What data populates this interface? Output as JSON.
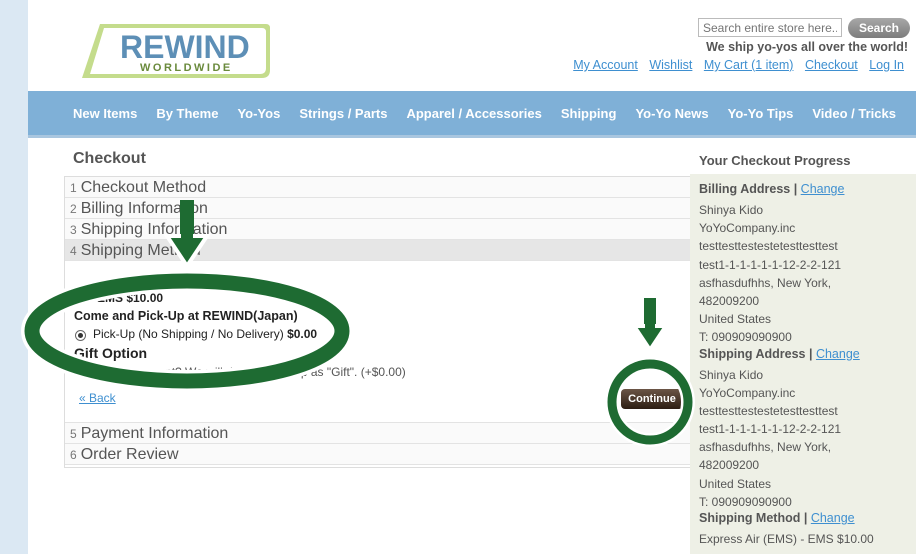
{
  "header": {
    "logo_text": "REWIND",
    "logo_sub": "WORLDWIDE",
    "search_placeholder": "Search entire store here...",
    "search_button": "Search",
    "ship_note": "We ship yo-yos all over the world!",
    "links": [
      "My Account",
      "Wishlist",
      "My Cart (1 item)",
      "Checkout",
      "Log In"
    ]
  },
  "nav": [
    "New Items",
    "By Theme",
    "Yo-Yos",
    "Strings / Parts",
    "Apparel / Accessories",
    "Shipping",
    "Yo-Yo News",
    "Yo-Yo Tips",
    "Video / Tricks"
  ],
  "checkout": {
    "title": "Checkout",
    "steps": [
      {
        "num": "1",
        "label": "Checkout Method"
      },
      {
        "num": "2",
        "label": "Billing Information"
      },
      {
        "num": "3",
        "label": "Shipping Information"
      },
      {
        "num": "4",
        "label": "Shipping Method"
      }
    ],
    "ems": "EMS $10.00",
    "pickup_heading": "Come and Pick-Up at REWIND(Japan)",
    "pickup_option": "Pick-Up (No Shipping / No Delivery)",
    "pickup_price": "$0.00",
    "gift_title": "Gift Option",
    "gift_text": "a present? We will do Gift W...ship as \"Gift\". (+$0.00)",
    "back": "« Back",
    "continue": "Continue",
    "steps_after": [
      {
        "num": "5",
        "label": "Payment Information"
      },
      {
        "num": "6",
        "label": "Order Review"
      }
    ]
  },
  "progress": {
    "title": "Your Checkout Progress",
    "change_label": "Change",
    "billing": {
      "heading": "Billing Address",
      "lines": [
        "Shinya Kido",
        "YoYoCompany.inc",
        "testtesttestestetesttesttest",
        "test1-1-1-1-1-1-12-2-2-121",
        "asfhasdufhhs, New York,",
        "482009200",
        "United States",
        "T: 090909090900"
      ]
    },
    "shipping": {
      "heading": "Shipping Address",
      "lines": [
        "Shinya Kido",
        "YoYoCompany.inc",
        "testtesttestestetesttesttest",
        "test1-1-1-1-1-1-12-2-2-121",
        "asfhasdufhhs, New York,",
        "482009200",
        "United States",
        "T: 090909090900"
      ]
    },
    "method": {
      "heading": "Shipping Method",
      "value": "Express Air (EMS) - EMS $10.00"
    }
  },
  "colors": {
    "nav": "#7fb0d7",
    "link": "#3e8fd0",
    "annotation": "#1e6b32"
  }
}
